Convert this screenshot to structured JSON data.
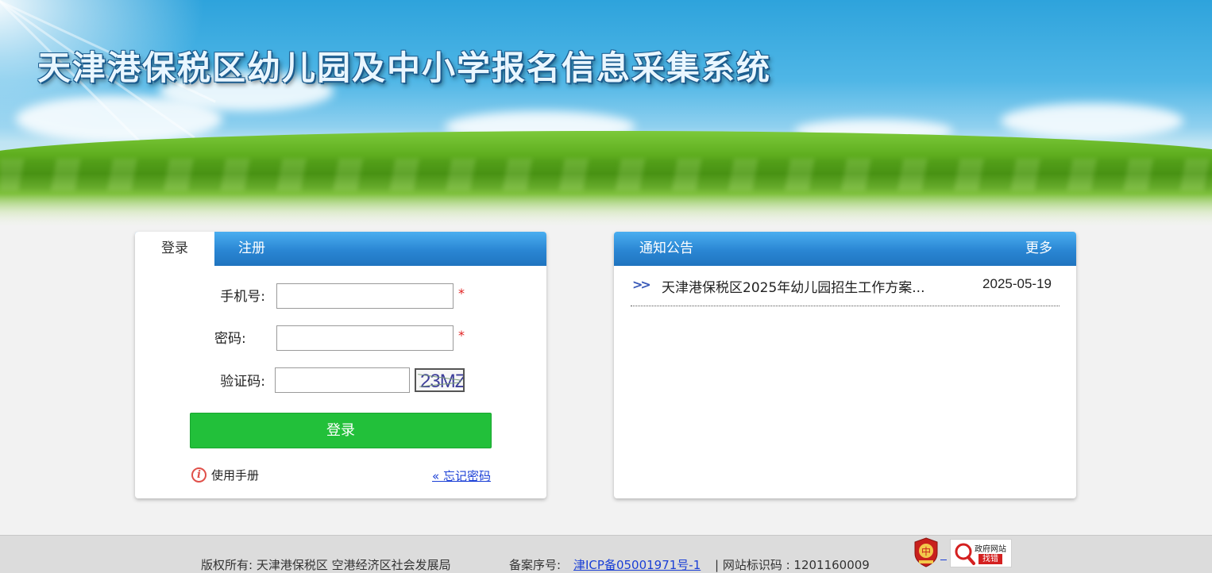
{
  "header": {
    "site_title": "天津港保税区幼儿园及中小学报名信息采集系统"
  },
  "login": {
    "tabs": {
      "login": "登录",
      "register": "注册"
    },
    "phone_label": "手机号:",
    "phone_value": "",
    "password_label": "密码:",
    "password_value": "",
    "captcha_label": "验证码:",
    "captcha_value": "",
    "captcha_image_text": "23MZ",
    "required_mark": "*",
    "submit_label": "登录",
    "manual_label": "使用手册",
    "forgot_label": "« 忘记密码"
  },
  "notices": {
    "title": "通知公告",
    "more_label": "更多",
    "items": [
      {
        "text": "天津港保税区2025年幼儿园招生工作方案...",
        "date": "2025-05-19"
      }
    ]
  },
  "footer": {
    "copyright": "版权所有: 天津港保税区 空港经济区社会发展局",
    "icp_prefix": "备案序号:",
    "icp_link": "津ICP备05001971号-1",
    "site_id": "| 网站标识码 : 1201160009",
    "gov_badge_top": "政府网站",
    "gov_badge_bottom": "找错"
  },
  "icons": {
    "info": "info-circle-icon",
    "chevron": "double-chevron-right-icon",
    "party_emblem": "party-emblem-icon",
    "gov_error": "gov-site-error-icon"
  },
  "colors": {
    "primary_blue": "#2a86d3",
    "login_green": "#22c03a",
    "required_red": "#e02020",
    "link_blue": "#1a3fd6"
  }
}
